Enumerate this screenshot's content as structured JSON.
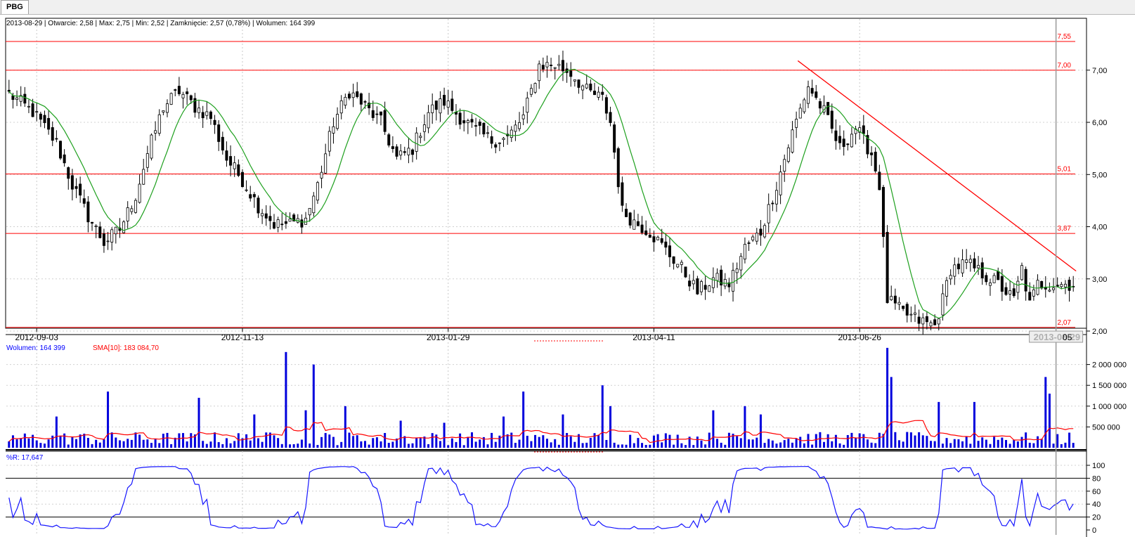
{
  "tab": {
    "label": "PBG"
  },
  "info": {
    "ohlc": "2013-08-29 | Otwarcie: 2,58 | Max: 2,75 | Min: 2,52 | Zamknięcie: 2,57 (0,78%)  | Wolumen: 164 399"
  },
  "volume_panel": {
    "label": "Wolumen: 164 399",
    "sma_label": "SMA[10]: 183 084,70"
  },
  "wr_panel": {
    "label": "%R: 17,647"
  },
  "cursor": {
    "date": "2013-08-29",
    "date_overflow": "05"
  },
  "colors": {
    "price_line": "#ff0000",
    "ma": "#1ea01e",
    "volume": "#0000dd",
    "wr": "#1515ff",
    "grid": "#c8c8c8"
  },
  "chart_data": [
    {
      "type": "candlestick",
      "panel": "price",
      "ylim": [
        2.0,
        7.9
      ],
      "y_ticks": [
        "2,00",
        "3,00",
        "4,00",
        "5,00",
        "6,00",
        "7,00"
      ],
      "x_tick_labels": [
        "2012-09-03",
        "2012-11-13",
        "2013-01-29",
        "2013-04-11",
        "2013-06-26"
      ],
      "levels": [
        {
          "label": "7,55",
          "value": 7.55
        },
        {
          "label": "7,00",
          "value": 7.0
        },
        {
          "label": "5,01",
          "value": 5.01
        },
        {
          "label": "3,87",
          "value": 3.87
        },
        {
          "label": "2,07",
          "value": 2.07
        }
      ],
      "trendline": {
        "start": {
          "date": "2013-05-31",
          "value": 7.18
        },
        "end": {
          "date": "2013-09-05",
          "value": 3.15
        }
      },
      "close_path": [
        [
          0,
          6.55
        ],
        [
          6,
          6.2
        ],
        [
          12,
          5.6
        ],
        [
          16,
          4.8
        ],
        [
          20,
          4.2
        ],
        [
          24,
          3.7
        ],
        [
          28,
          3.95
        ],
        [
          32,
          4.6
        ],
        [
          35,
          5.4
        ],
        [
          39,
          6.3
        ],
        [
          43,
          6.6
        ],
        [
          47,
          6.3
        ],
        [
          51,
          6.1
        ],
        [
          55,
          5.3
        ],
        [
          59,
          4.9
        ],
        [
          63,
          4.4
        ],
        [
          67,
          4.05
        ],
        [
          71,
          4.05
        ],
        [
          75,
          4.15
        ],
        [
          78,
          4.8
        ],
        [
          82,
          6.0
        ],
        [
          86,
          6.6
        ],
        [
          90,
          6.3
        ],
        [
          94,
          6.0
        ],
        [
          98,
          5.3
        ],
        [
          102,
          5.5
        ],
        [
          106,
          6.2
        ],
        [
          110,
          6.4
        ],
        [
          114,
          6.1
        ],
        [
          118,
          5.85
        ],
        [
          122,
          5.65
        ],
        [
          126,
          5.7
        ],
        [
          130,
          6.1
        ],
        [
          134,
          7.1
        ],
        [
          138,
          7.1
        ],
        [
          142,
          6.95
        ],
        [
          146,
          6.6
        ],
        [
          150,
          6.45
        ],
        [
          152,
          6.0
        ],
        [
          155,
          4.3
        ],
        [
          158,
          4.1
        ],
        [
          162,
          3.9
        ],
        [
          166,
          3.55
        ],
        [
          170,
          3.2
        ],
        [
          174,
          2.75
        ],
        [
          178,
          3.0
        ],
        [
          182,
          2.9
        ],
        [
          186,
          3.6
        ],
        [
          190,
          3.9
        ],
        [
          194,
          4.8
        ],
        [
          198,
          5.8
        ],
        [
          202,
          6.7
        ],
        [
          206,
          6.2
        ],
        [
          210,
          5.5
        ],
        [
          214,
          5.9
        ],
        [
          218,
          5.4
        ],
        [
          220,
          4.8
        ],
        [
          222,
          2.6
        ],
        [
          226,
          2.35
        ],
        [
          230,
          2.2
        ],
        [
          234,
          2.1
        ],
        [
          236,
          2.6
        ],
        [
          238,
          3.2
        ],
        [
          242,
          3.3
        ],
        [
          246,
          3.1
        ],
        [
          250,
          2.9
        ],
        [
          254,
          2.6
        ],
        [
          256,
          3.2
        ],
        [
          258,
          2.5
        ],
        [
          260,
          2.9
        ]
      ],
      "ma_period": 10
    },
    {
      "type": "bar",
      "panel": "volume",
      "series": [
        {
          "name": "Wolumen",
          "color": "#0000dd"
        },
        {
          "name": "SMA[10]",
          "color": "#ff0000"
        }
      ],
      "ylim": [
        0,
        2500000
      ],
      "y_ticks": [
        "500 000",
        "1 000 000",
        "1 500 000",
        "2 000 000"
      ],
      "spikes": [
        [
          12,
          750000
        ],
        [
          25,
          1350000
        ],
        [
          48,
          1200000
        ],
        [
          62,
          800000
        ],
        [
          70,
          2300000
        ],
        [
          75,
          900000
        ],
        [
          77,
          2000000
        ],
        [
          85,
          1000000
        ],
        [
          99,
          650000
        ],
        [
          110,
          600000
        ],
        [
          125,
          750000
        ],
        [
          130,
          1350000
        ],
        [
          140,
          800000
        ],
        [
          150,
          1500000
        ],
        [
          152,
          1000000
        ],
        [
          178,
          900000
        ],
        [
          186,
          1000000
        ],
        [
          190,
          800000
        ],
        [
          222,
          2400000
        ],
        [
          223,
          1700000
        ],
        [
          235,
          1100000
        ],
        [
          244,
          1100000
        ],
        [
          262,
          1700000
        ],
        [
          263,
          1300000
        ]
      ],
      "current": 164399,
      "sma": 183084.7
    },
    {
      "type": "line",
      "panel": "williams_r",
      "series": [
        {
          "name": "%R",
          "color": "#1515ff"
        }
      ],
      "ylim": [
        0,
        100
      ],
      "y_ticks": [
        "0",
        "20",
        "40",
        "60",
        "80",
        "100"
      ],
      "reference_lines": [
        20,
        80
      ],
      "current": 17.647
    }
  ]
}
